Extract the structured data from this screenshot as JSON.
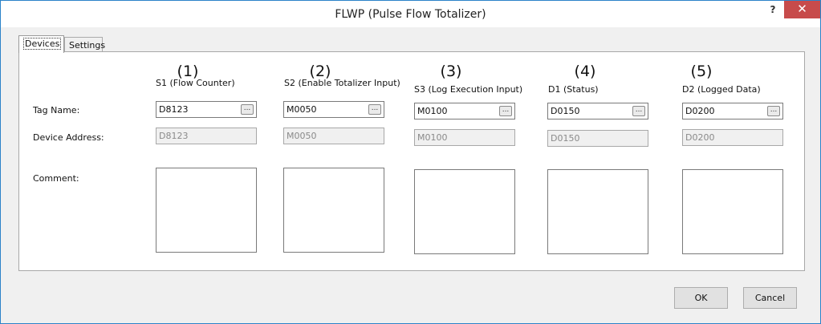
{
  "window": {
    "title": "FLWP (Pulse Flow Totalizer)",
    "help_glyph": "?",
    "close_glyph": "✕"
  },
  "tabs": [
    {
      "label": "Devices",
      "active": true
    },
    {
      "label": "Settings",
      "active": false
    }
  ],
  "row_labels": {
    "tag_name": "Tag Name:",
    "device_address": "Device Address:",
    "comment": "Comment:"
  },
  "columns": [
    {
      "number": "(1)",
      "header": "S1 (Flow Counter)",
      "tag": "D8123",
      "address": "D8123",
      "comment": ""
    },
    {
      "number": "(2)",
      "header": "S2 (Enable Totalizer Input)",
      "tag": "M0050",
      "address": "M0050",
      "comment": ""
    },
    {
      "number": "(3)",
      "header": "S3 (Log Execution Input)",
      "tag": "M0100",
      "address": "M0100",
      "comment": ""
    },
    {
      "number": "(4)",
      "header": "D1 (Status)",
      "tag": "D0150",
      "address": "D0150",
      "comment": ""
    },
    {
      "number": "(5)",
      "header": "D2 (Logged Data)",
      "tag": "D0200",
      "address": "D0200",
      "comment": ""
    }
  ],
  "browse_glyph": "...",
  "buttons": {
    "ok": "OK",
    "cancel": "Cancel"
  }
}
